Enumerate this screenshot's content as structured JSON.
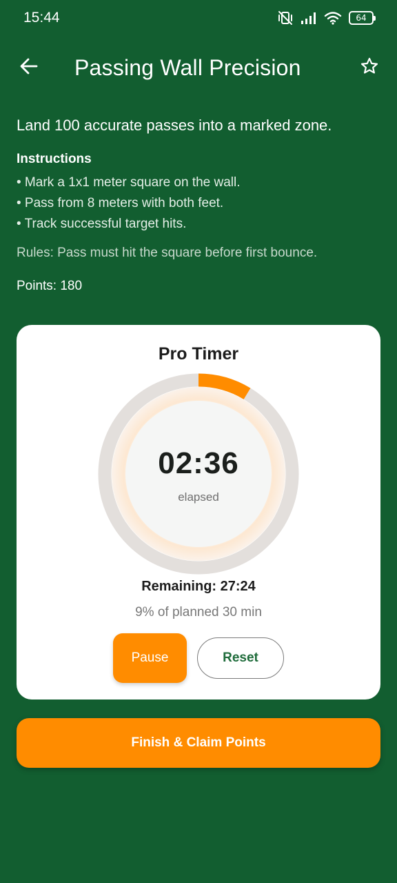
{
  "status_bar": {
    "time": "15:44",
    "battery": "64",
    "icons": [
      "mute-vibrate-icon",
      "signal-icon",
      "wifi-icon",
      "battery-icon"
    ]
  },
  "app_bar": {
    "title": "Passing Wall Precision",
    "back_icon": "arrow-left-icon",
    "favorite_icon": "star-outline-icon"
  },
  "content": {
    "description": "Land 100 accurate passes into a marked zone.",
    "instructions_heading": "Instructions",
    "instructions": [
      "• Mark a 1x1 meter square on the wall.",
      "• Pass from 8 meters with both feet.",
      "• Track successful target hits."
    ],
    "rules": "Rules: Pass must hit the square before first bounce.",
    "points": "Points: 180"
  },
  "timer": {
    "title": "Pro Timer",
    "elapsed": "02:36",
    "elapsed_caption": "elapsed",
    "remaining": "Remaining: 27:24",
    "progress_text": "9% of planned 30 min",
    "progress_fraction": 0.0867,
    "pause_label": "Pause",
    "reset_label": "Reset"
  },
  "finish_label": "Finish & Claim Points",
  "colors": {
    "background": "#125e30",
    "accent": "#ff8c00",
    "card": "#ffffff",
    "ring_track": "#e3dfdc"
  }
}
